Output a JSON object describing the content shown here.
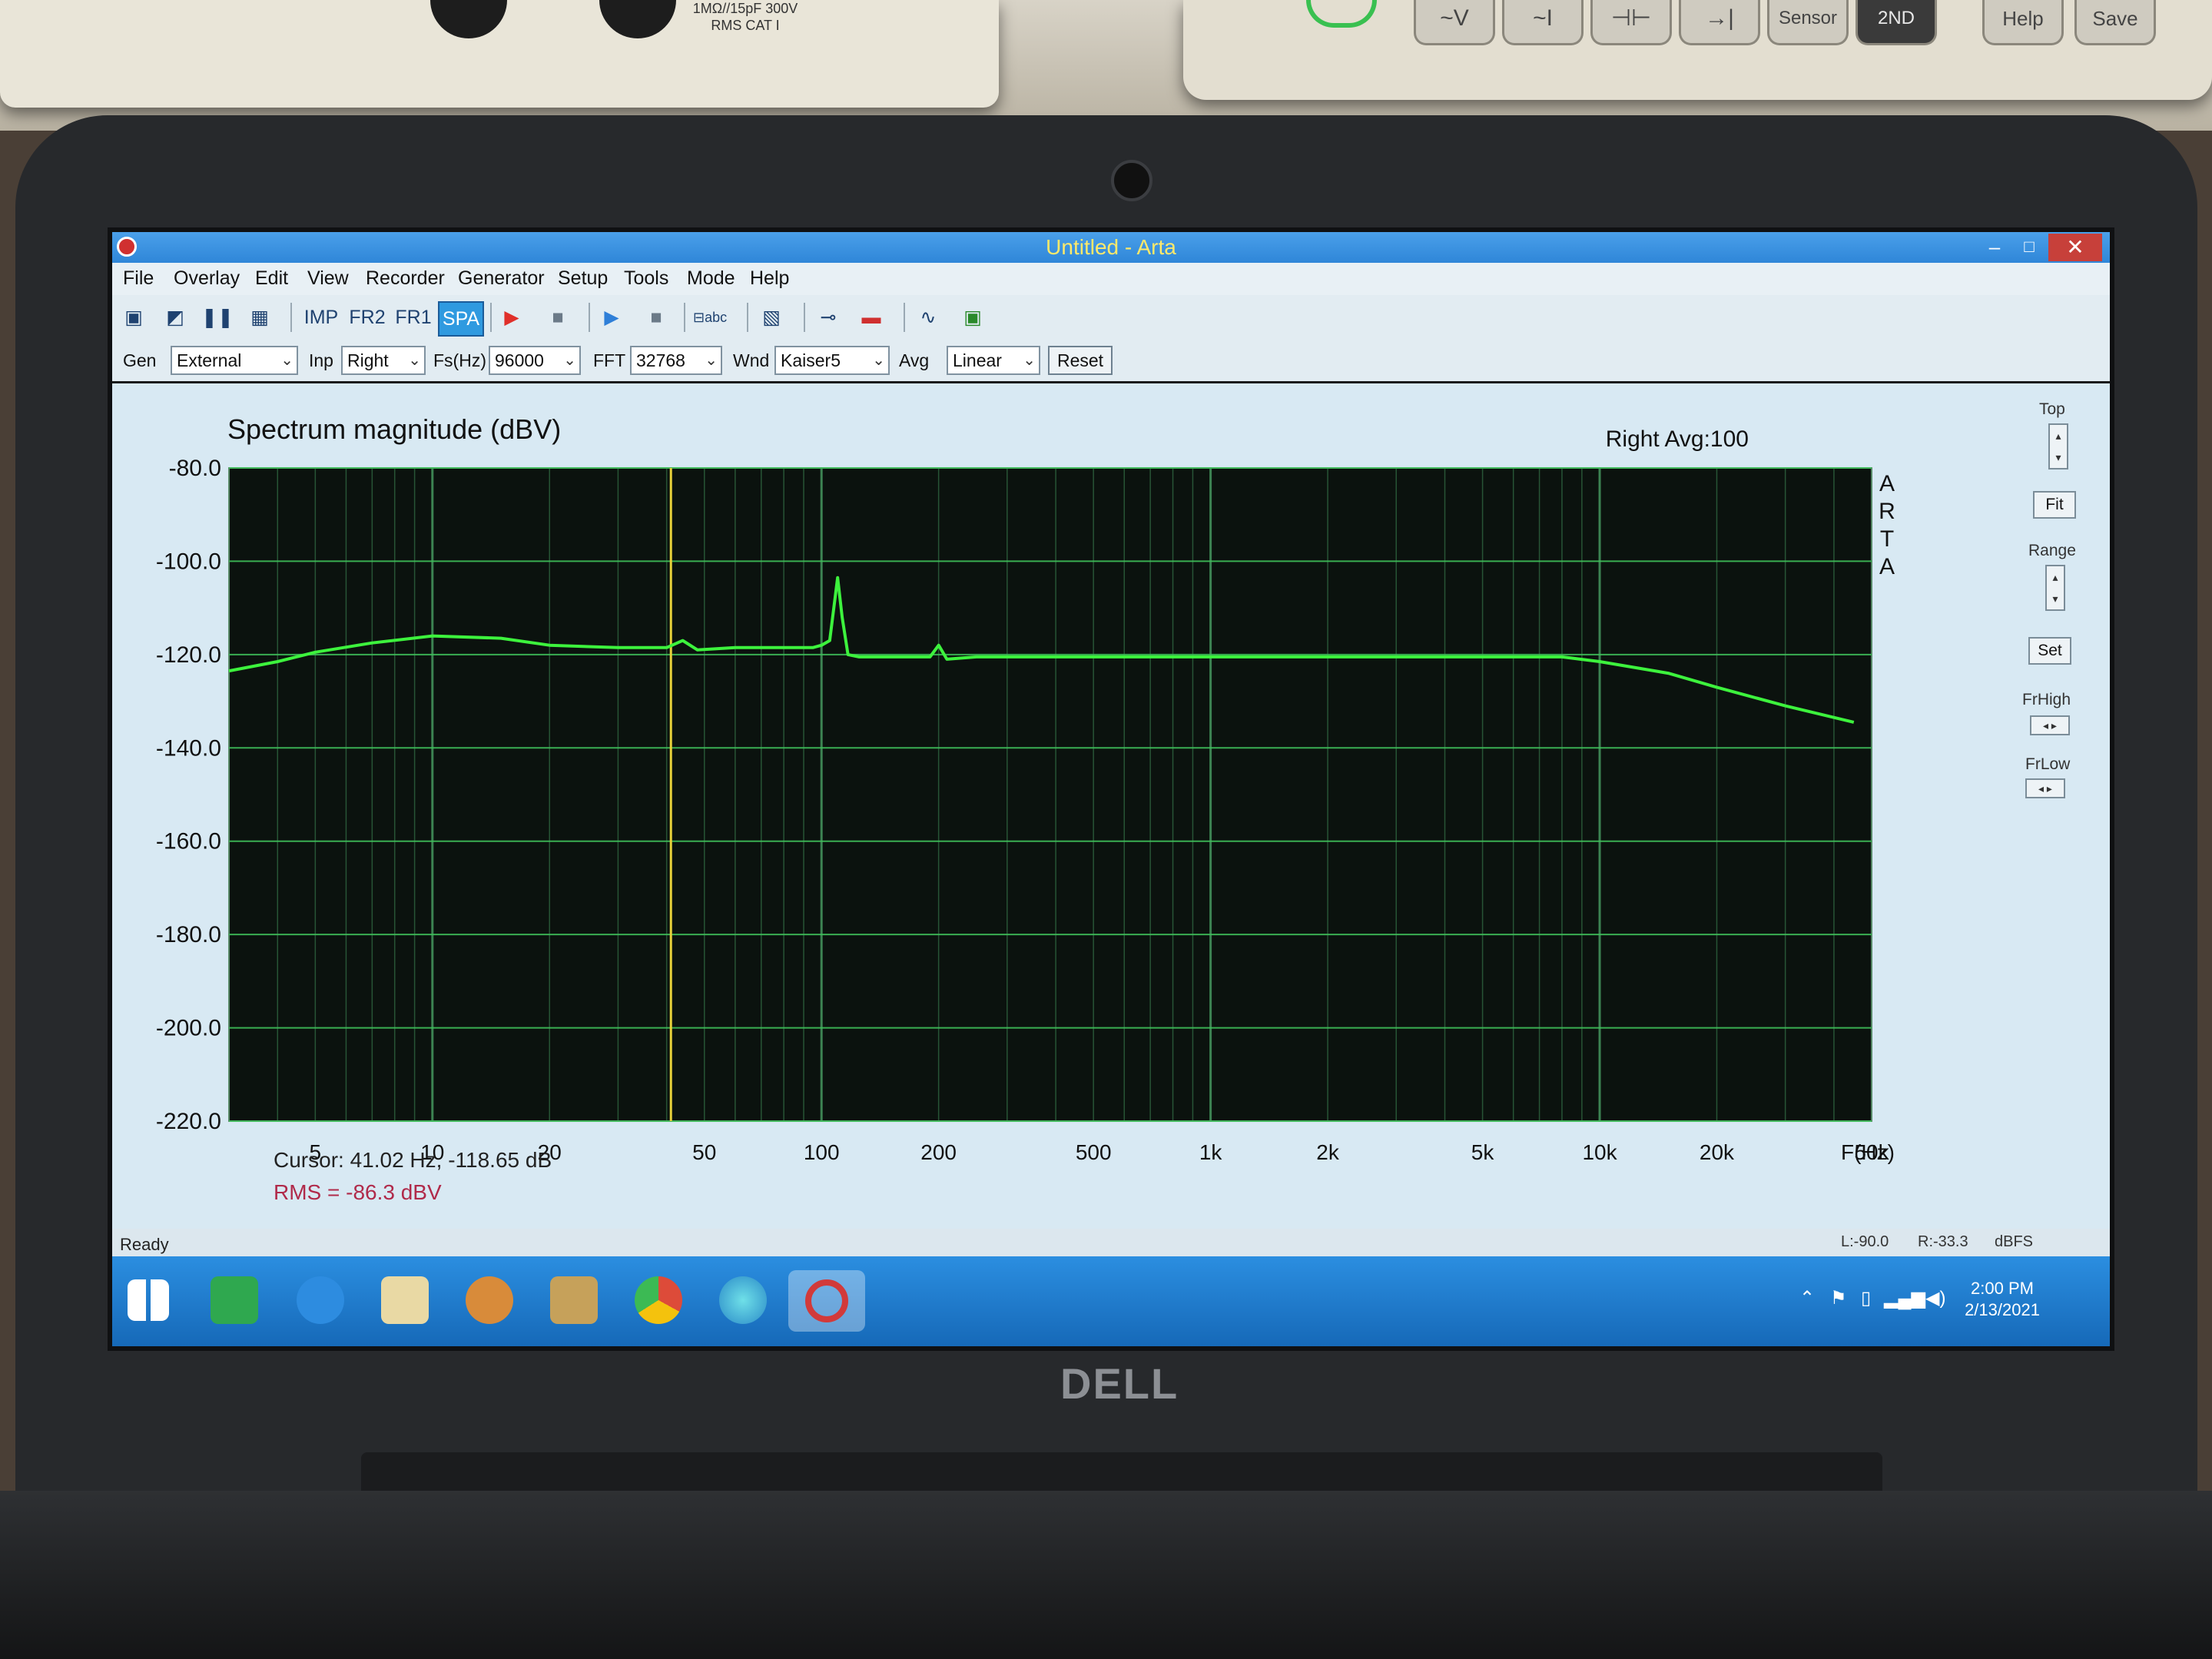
{
  "window": {
    "title": "Untitled - Arta",
    "minimize": "–",
    "maximize": "□",
    "close": "✕"
  },
  "instruments": {
    "label": "1MΩ//15pF 300V RMS CAT I",
    "buttons": [
      "~V",
      "~I",
      "⊣⊢",
      "→|",
      "Sensor",
      "2ND",
      "Help",
      "Save"
    ]
  },
  "brand": "DELL",
  "menu": [
    "File",
    "Overlay",
    "Edit",
    "View",
    "Recorder",
    "Generator",
    "Setup",
    "Tools",
    "Mode",
    "Help"
  ],
  "toolbar": {
    "modes": [
      "IMP",
      "FR2",
      "FR1",
      "SPA"
    ],
    "active_mode": "SPA",
    "icons": [
      "copy-icon",
      "open-icon",
      "pause-icon",
      "grid-icon",
      "record-icon",
      "stop-icon",
      "play-icon",
      "stop-icon",
      "abc-icon",
      "hatch-icon",
      "probe-icon",
      "meter-icon",
      "waveform-icon",
      "scope-icon"
    ]
  },
  "controls": {
    "gen_label": "Gen",
    "gen_value": "External",
    "inp_label": "Inp",
    "inp_value": "Right",
    "fs_label": "Fs(Hz)",
    "fs_value": "96000",
    "fft_label": "FFT",
    "fft_value": "32768",
    "wnd_label": "Wnd",
    "wnd_value": "Kaiser5",
    "avg_label": "Avg",
    "avg_value": "Linear",
    "reset_label": "Reset"
  },
  "side_panel": {
    "top_label": "Top",
    "fit_label": "Fit",
    "range_label": "Range",
    "set_label": "Set",
    "frhigh_label": "FrHigh",
    "frlow_label": "FrLow"
  },
  "chart_data": {
    "type": "line",
    "title": "Spectrum magnitude (dBV)",
    "info": "Right  Avg:100",
    "watermark": "ARTA",
    "xlabel": "F(Hz)",
    "x_scale": "log",
    "xlim": [
      3,
      50000
    ],
    "ylim": [
      -220,
      -80
    ],
    "y_ticks": [
      "-80.0",
      "-100.0",
      "-120.0",
      "-140.0",
      "-160.0",
      "-180.0",
      "-200.0",
      "-220.0"
    ],
    "y_tick_values": [
      -80,
      -100,
      -120,
      -140,
      -160,
      -180,
      -200,
      -220
    ],
    "x_ticks": [
      "5",
      "10",
      "20",
      "50",
      "100",
      "200",
      "500",
      "1k",
      "2k",
      "5k",
      "10k",
      "20k",
      "50k"
    ],
    "x_tick_values": [
      5,
      10,
      20,
      50,
      100,
      200,
      500,
      1000,
      2000,
      5000,
      10000,
      20000,
      50000
    ],
    "grid": true,
    "cursor_hz": 41.02,
    "series": [
      {
        "color": "#3df23d",
        "x": [
          3,
          4,
          5,
          7,
          10,
          15,
          20,
          30,
          40,
          44,
          48,
          60,
          80,
          95,
          100,
          105,
          110,
          113,
          117,
          125,
          150,
          190,
          200,
          210,
          250,
          300,
          500,
          1000,
          2000,
          5000,
          8000,
          10000,
          15000,
          20000,
          30000,
          45000
        ],
        "y": [
          -123.5,
          -121.5,
          -119.5,
          -117.5,
          -116,
          -116.5,
          -118,
          -118.5,
          -118.5,
          -117,
          -119,
          -118.5,
          -118.5,
          -118.5,
          -118,
          -117,
          -103.5,
          -112,
          -120,
          -120.5,
          -120.5,
          -120.5,
          -118,
          -121,
          -120.5,
          -120.5,
          -120.5,
          -120.5,
          -120.5,
          -120.5,
          -120.5,
          -121.5,
          -124,
          -127,
          -131,
          -134.5
        ]
      }
    ],
    "cursor_text": "Cursor: 41.02 Hz, -118.65 dB",
    "rms_text": "RMS =  -86.3 dBV"
  },
  "status": {
    "text": "Ready",
    "left_level": "L:-90.0",
    "right_level": "R:-33.3",
    "unit": "dBFS"
  },
  "taskbar": {
    "time": "2:00 PM",
    "date": "2/13/2021"
  }
}
